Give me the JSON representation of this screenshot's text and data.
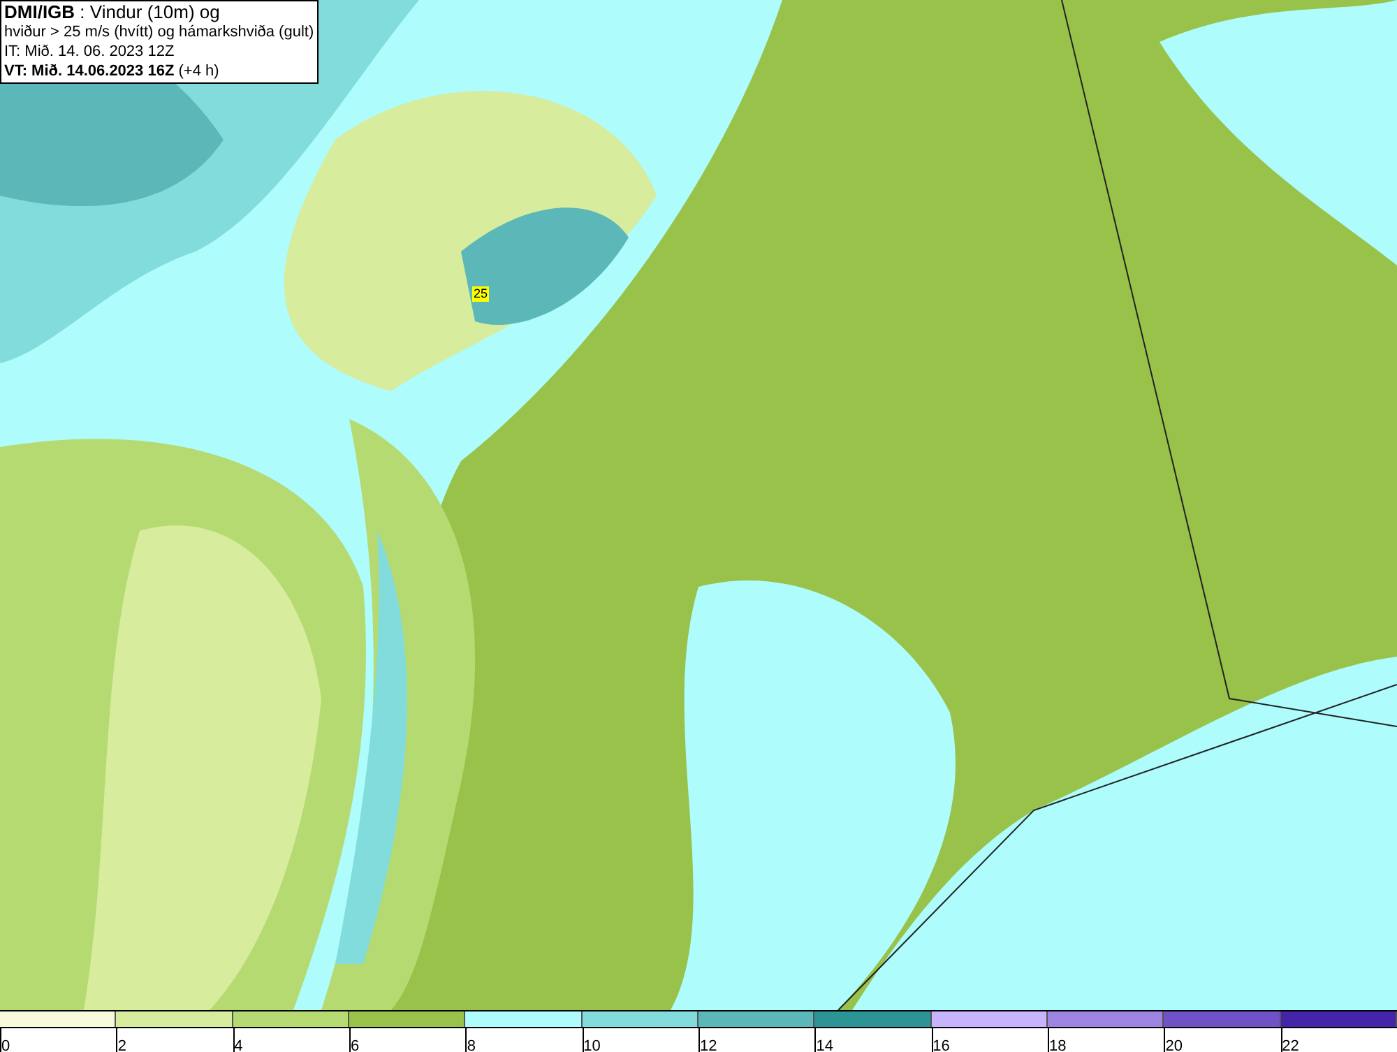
{
  "header": {
    "lines": [
      "**DMI/IGB** : Vindur (10m) og",
      "hviður > 25 m/s (hvítt) og hámarkshviða (gult)",
      "IT: Mið. 14. 06. 2023 12Z",
      "**VT: Mið. 14.06.2023 16Z** (+4 h)"
    ]
  },
  "map": {
    "gust_marker": "25"
  },
  "legend": {
    "bins": [
      {
        "label": "0",
        "color": "#f7fbdc"
      },
      {
        "label": "2",
        "color": "#d7ec9c"
      },
      {
        "label": "4",
        "color": "#b6da72"
      },
      {
        "label": "6",
        "color": "#98c24a"
      },
      {
        "label": "8",
        "color": "#aefcfc"
      },
      {
        "label": "10",
        "color": "#82dcdc"
      },
      {
        "label": "12",
        "color": "#5cb8b8"
      },
      {
        "label": "14",
        "color": "#2c9494"
      },
      {
        "label": "16",
        "color": "#c8b4fc"
      },
      {
        "label": "18",
        "color": "#9c84e0"
      },
      {
        "label": "20",
        "color": "#6e52c6"
      },
      {
        "label": "22",
        "color": "#4424a8"
      }
    ]
  }
}
